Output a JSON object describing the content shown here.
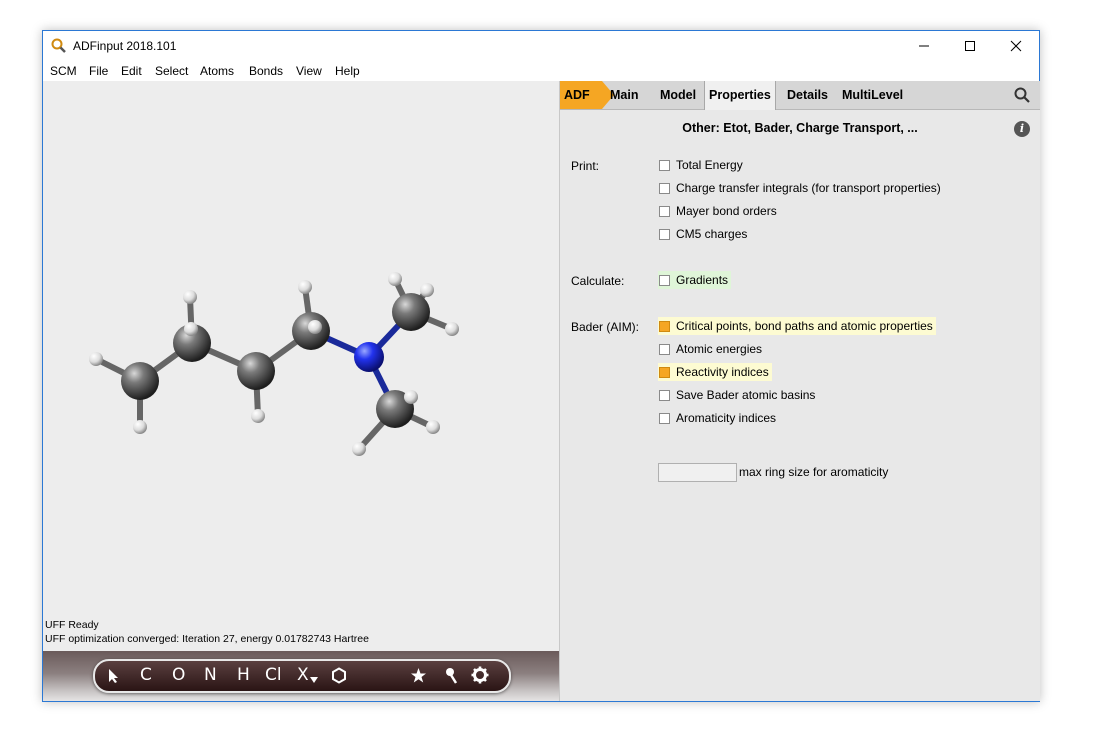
{
  "window": {
    "title": "ADFinput 2018.101"
  },
  "menu": [
    "SCM",
    "File",
    "Edit",
    "Select",
    "Atoms",
    "Bonds",
    "View",
    "Help"
  ],
  "status": {
    "line1": "UFF Ready",
    "line2": "UFF optimization converged: Iteration 27, energy 0.01782743 Hartree"
  },
  "toolbar": {
    "tools": [
      "C",
      "O",
      "N",
      "H",
      "Cl",
      "X"
    ]
  },
  "tabs": [
    "ADF",
    "Main",
    "Model",
    "Properties",
    "Details",
    "MultiLevel"
  ],
  "active_tab": "Properties",
  "colors": {
    "accent": "#f5a623",
    "nitrogen": "#2233ee",
    "carbon": "#555555"
  },
  "panel": {
    "title": "Other: Etot, Bader, Charge Transport, ...",
    "print_label": "Print:",
    "print_options": [
      {
        "label": "Total Energy",
        "checked": false
      },
      {
        "label": "Charge transfer integrals (for transport properties)",
        "checked": false
      },
      {
        "label": "Mayer bond orders",
        "checked": false
      },
      {
        "label": "CM5 charges",
        "checked": false
      }
    ],
    "calculate_label": "Calculate:",
    "calculate_options": [
      {
        "label": "Gradients",
        "checked": false
      }
    ],
    "bader_label": "Bader (AIM):",
    "bader_options": [
      {
        "label": "Critical points, bond paths and atomic properties",
        "checked": true
      },
      {
        "label": "Atomic energies",
        "checked": false
      },
      {
        "label": "Reactivity indices",
        "checked": true
      },
      {
        "label": "Save Bader atomic basins",
        "checked": false
      },
      {
        "label": "Aromaticity indices",
        "checked": false
      }
    ],
    "ring_size": {
      "value": "",
      "label": "max ring size for aromaticity"
    }
  }
}
